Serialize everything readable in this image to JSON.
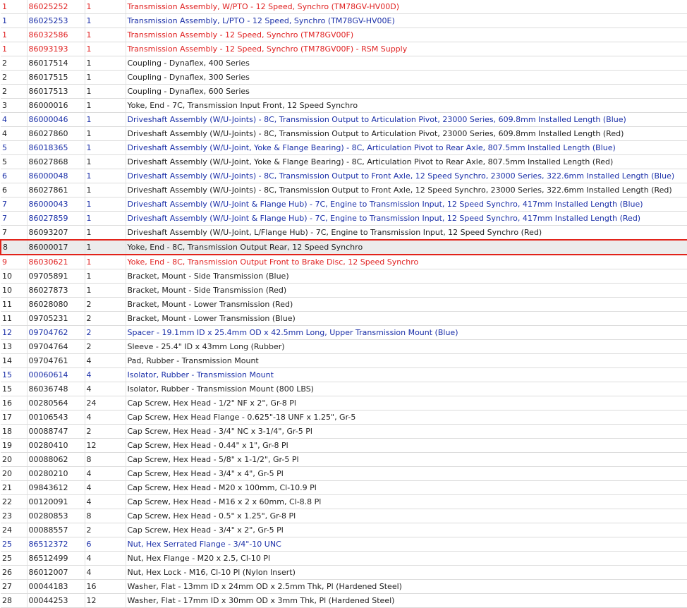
{
  "parts_list": {
    "rows": [
      {
        "ref": "1",
        "part": "86025252",
        "qty": "1",
        "desc": "Transmission Assembly, W/PTO - 12 Speed, Synchro (TM78GV-HV00D)",
        "style": "red"
      },
      {
        "ref": "1",
        "part": "86025253",
        "qty": "1",
        "desc": "Transmission Assembly, L/PTO - 12 Speed, Synchro (TM78GV-HV00E)",
        "style": "blue"
      },
      {
        "ref": "1",
        "part": "86032586",
        "qty": "1",
        "desc": "Transmission Assembly - 12 Speed, Synchro (TM78GV00F)",
        "style": "red"
      },
      {
        "ref": "1",
        "part": "86093193",
        "qty": "1",
        "desc": "Transmission Assembly - 12 Speed, Synchro (TM78GV00F) - RSM Supply",
        "style": "red"
      },
      {
        "ref": "2",
        "part": "86017514",
        "qty": "1",
        "desc": "Coupling - Dynaflex, 400 Series",
        "style": "black"
      },
      {
        "ref": "2",
        "part": "86017515",
        "qty": "1",
        "desc": "Coupling - Dynaflex, 300 Series",
        "style": "black"
      },
      {
        "ref": "2",
        "part": "86017513",
        "qty": "1",
        "desc": "Coupling - Dynaflex, 600 Series",
        "style": "black"
      },
      {
        "ref": "3",
        "part": "86000016",
        "qty": "1",
        "desc": "Yoke, End - 7C, Transmission Input Front, 12 Speed Synchro",
        "style": "black"
      },
      {
        "ref": "4",
        "part": "86000046",
        "qty": "1",
        "desc": "Driveshaft Assembly (W/U-Joints) - 8C, Transmission Output to Articulation Pivot, 23000 Series, 609.8mm Installed Length (Blue)",
        "style": "blue"
      },
      {
        "ref": "4",
        "part": "86027860",
        "qty": "1",
        "desc": "Driveshaft Assembly (W/U-Joints) - 8C, Transmission Output to Articulation Pivot, 23000 Series, 609.8mm Installed Length (Red)",
        "style": "black"
      },
      {
        "ref": "5",
        "part": "86018365",
        "qty": "1",
        "desc": "Driveshaft Assembly (W/U-Joint, Yoke & Flange Bearing) - 8C, Articulation Pivot to Rear Axle, 807.5mm Installed Length (Blue)",
        "style": "blue"
      },
      {
        "ref": "5",
        "part": "86027868",
        "qty": "1",
        "desc": "Driveshaft Assembly (W/U-Joint, Yoke & Flange Bearing) - 8C, Articulation Pivot to Rear Axle, 807.5mm Installed Length (Red)",
        "style": "black"
      },
      {
        "ref": "6",
        "part": "86000048",
        "qty": "1",
        "desc": "Driveshaft Assembly (W/U-Joints) - 8C, Transmission Output to Front Axle, 12 Speed Synchro, 23000 Series, 322.6mm Installed Length (Blue)",
        "style": "blue"
      },
      {
        "ref": "6",
        "part": "86027861",
        "qty": "1",
        "desc": "Driveshaft Assembly (W/U-Joints) - 8C, Transmission Output to Front Axle, 12 Speed Synchro, 23000 Series, 322.6mm Installed Length (Red)",
        "style": "black"
      },
      {
        "ref": "7",
        "part": "86000043",
        "qty": "1",
        "desc": "Driveshaft Assembly (W/U-Joint & Flange Hub) - 7C, Engine to Transmission Input, 12 Speed Synchro, 417mm Installed Length (Blue)",
        "style": "blue"
      },
      {
        "ref": "7",
        "part": "86027859",
        "qty": "1",
        "desc": "Driveshaft Assembly (W/U-Joint & Flange Hub) - 7C, Engine to Transmission Input, 12 Speed Synchro, 417mm Installed Length (Red)",
        "style": "blue"
      },
      {
        "ref": "7",
        "part": "86093207",
        "qty": "1",
        "desc": "Driveshaft Assembly (W/U-Joint, L/Flange Hub) - 7C, Engine to Transmission Input, 12 Speed Synchro (Red)",
        "style": "black"
      },
      {
        "ref": "8",
        "part": "86000017",
        "qty": "1",
        "desc": "Yoke, End - 8C, Transmission Output Rear, 12 Speed Synchro",
        "style": "black",
        "selected": true
      },
      {
        "ref": "9",
        "part": "86030621",
        "qty": "1",
        "desc": "Yoke, End - 8C, Transmission Output Front to Brake Disc, 12 Speed Synchro",
        "style": "red"
      },
      {
        "ref": "10",
        "part": "09705891",
        "qty": "1",
        "desc": "Bracket, Mount - Side Transmission (Blue)",
        "style": "black"
      },
      {
        "ref": "10",
        "part": "86027873",
        "qty": "1",
        "desc": "Bracket, Mount - Side Transmission (Red)",
        "style": "black"
      },
      {
        "ref": "11",
        "part": "86028080",
        "qty": "2",
        "desc": "Bracket, Mount - Lower Transmission (Red)",
        "style": "black"
      },
      {
        "ref": "11",
        "part": "09705231",
        "qty": "2",
        "desc": "Bracket, Mount - Lower Transmission (Blue)",
        "style": "black"
      },
      {
        "ref": "12",
        "part": "09704762",
        "qty": "2",
        "desc": "Spacer - 19.1mm ID x 25.4mm OD x 42.5mm Long, Upper Transmission Mount (Blue)",
        "style": "blue"
      },
      {
        "ref": "13",
        "part": "09704764",
        "qty": "2",
        "desc": "Sleeve - 25.4\" ID x 43mm Long (Rubber)",
        "style": "black"
      },
      {
        "ref": "14",
        "part": "09704761",
        "qty": "4",
        "desc": "Pad, Rubber - Transmission Mount",
        "style": "black"
      },
      {
        "ref": "15",
        "part": "00060614",
        "qty": "4",
        "desc": "Isolator, Rubber - Transmission Mount",
        "style": "blue"
      },
      {
        "ref": "15",
        "part": "86036748",
        "qty": "4",
        "desc": "Isolator, Rubber - Transmission Mount (800 LBS)",
        "style": "black"
      },
      {
        "ref": "16",
        "part": "00280564",
        "qty": "24",
        "desc": "Cap Screw, Hex Head - 1/2\" NF x 2\", Gr-8 Pl",
        "style": "black"
      },
      {
        "ref": "17",
        "part": "00106543",
        "qty": "4",
        "desc": "Cap Screw, Hex Head Flange - 0.625\"-18 UNF x 1.25\", Gr-5",
        "style": "black"
      },
      {
        "ref": "18",
        "part": "00088747",
        "qty": "2",
        "desc": "Cap Screw, Hex Head - 3/4\" NC x 3-1/4\", Gr-5 Pl",
        "style": "black"
      },
      {
        "ref": "19",
        "part": "00280410",
        "qty": "12",
        "desc": "Cap Screw, Hex Head - 0.44\" x 1\", Gr-8 Pl",
        "style": "black"
      },
      {
        "ref": "20",
        "part": "00088062",
        "qty": "8",
        "desc": "Cap Screw, Hex Head - 5/8\" x 1-1/2\", Gr-5 Pl",
        "style": "black"
      },
      {
        "ref": "20",
        "part": "00280210",
        "qty": "4",
        "desc": "Cap Screw, Hex Head - 3/4\" x 4\", Gr-5 Pl",
        "style": "black"
      },
      {
        "ref": "21",
        "part": "09843612",
        "qty": "4",
        "desc": "Cap Screw, Hex Head - M20 x 100mm, Cl-10.9 Pl",
        "style": "black"
      },
      {
        "ref": "22",
        "part": "00120091",
        "qty": "4",
        "desc": "Cap Screw, Hex Head - M16 x 2 x 60mm, Cl-8.8 Pl",
        "style": "black"
      },
      {
        "ref": "23",
        "part": "00280853",
        "qty": "8",
        "desc": "Cap Screw, Hex Head - 0.5\" x 1.25\", Gr-8 Pl",
        "style": "black"
      },
      {
        "ref": "24",
        "part": "00088557",
        "qty": "2",
        "desc": "Cap Screw, Hex Head - 3/4\" x 2\", Gr-5 Pl",
        "style": "black"
      },
      {
        "ref": "25",
        "part": "86512372",
        "qty": "6",
        "desc": "Nut, Hex Serrated Flange - 3/4\"-10 UNC",
        "style": "blue"
      },
      {
        "ref": "25",
        "part": "86512499",
        "qty": "4",
        "desc": "Nut, Hex Flange - M20 x 2.5, Cl-10 Pl",
        "style": "black"
      },
      {
        "ref": "26",
        "part": "86012007",
        "qty": "4",
        "desc": "Nut, Hex Lock - M16, Cl-10 Pl (Nylon Insert)",
        "style": "black"
      },
      {
        "ref": "27",
        "part": "00044183",
        "qty": "16",
        "desc": "Washer, Flat - 13mm ID x 24mm OD x 2.5mm Thk, Pl (Hardened Steel)",
        "style": "black"
      },
      {
        "ref": "28",
        "part": "00044253",
        "qty": "12",
        "desc": "Washer, Flat - 17mm ID x 30mm OD x 3mm Thk, Pl (Hardened Steel)",
        "style": "black"
      }
    ]
  },
  "colors": {
    "text": "#222222",
    "red": "#e01f1f",
    "blue": "#1a2fa8",
    "selection_border": "#e2231a",
    "selection_fill": "#ececec",
    "grid": "#dcdcdc"
  }
}
